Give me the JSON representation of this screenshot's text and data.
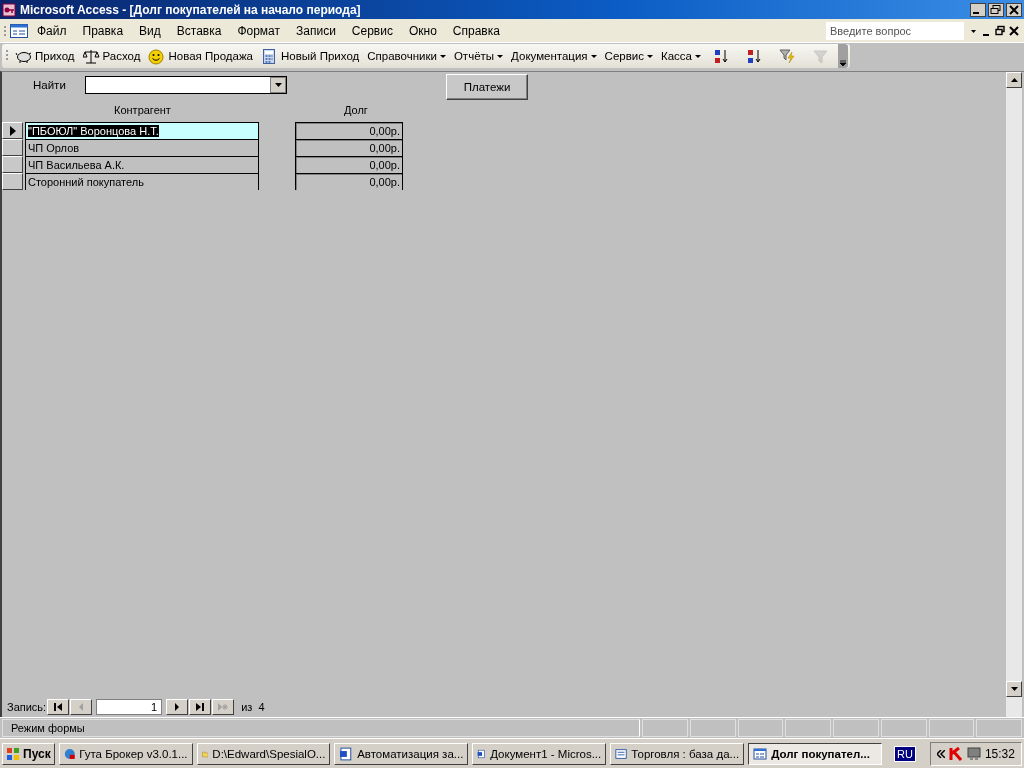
{
  "window": {
    "title": "Microsoft Access - [Долг покупателей на начало периода]"
  },
  "menu": [
    "Файл",
    "Правка",
    "Вид",
    "Вставка",
    "Формат",
    "Записи",
    "Сервис",
    "Окно",
    "Справка"
  ],
  "help_search": {
    "placeholder": "Введите вопрос"
  },
  "toolbar": [
    {
      "kind": "piggy",
      "label": "Приход"
    },
    {
      "kind": "scales",
      "label": "Расход"
    },
    {
      "kind": "smiley",
      "label": "Новая Продажа"
    },
    {
      "kind": "calculator",
      "label": "Новый Приход"
    },
    {
      "kind": "menu",
      "label": "Справочники"
    },
    {
      "kind": "menu",
      "label": "Отчёты"
    },
    {
      "kind": "menu",
      "label": "Документация"
    },
    {
      "kind": "menu",
      "label": "Сервис"
    },
    {
      "kind": "menu",
      "label": "Касса"
    },
    {
      "kind": "sort-asc",
      "disabled": false
    },
    {
      "kind": "sort-desc",
      "disabled": false
    },
    {
      "kind": "filter-apply",
      "disabled": false
    },
    {
      "kind": "filter",
      "disabled": true
    }
  ],
  "form": {
    "search_label": "Найти",
    "button": "Платежи",
    "columns": [
      "Контрагент",
      "Долг"
    ],
    "rows": [
      {
        "selected": true,
        "name": "\"ПБОЮЛ\" Воронцова Н.Т.",
        "debt": "0,00р."
      },
      {
        "selected": false,
        "name": "ЧП Орлов",
        "debt": "0,00р."
      },
      {
        "selected": false,
        "name": "ЧП Васильева А.К.",
        "debt": "0,00р."
      },
      {
        "selected": false,
        "name": "Сторонний покупатель",
        "debt": "0,00р."
      }
    ]
  },
  "record_nav": {
    "label": "Запись:",
    "current": "1",
    "of": "из",
    "total": "4"
  },
  "status_bar": "Режим формы",
  "taskbar": {
    "start": "Пуск",
    "tasks": [
      {
        "label": "Гута Брокер v3.0.1...",
        "selected": false
      },
      {
        "label": "D:\\Edward\\SpesialO...",
        "selected": false
      },
      {
        "label": "Автоматизация за...",
        "selected": false
      },
      {
        "label": "Документ1 - Micros...",
        "selected": false
      },
      {
        "label": "Торговля : база да...",
        "selected": false
      },
      {
        "label": "Долг покупател...",
        "selected": true
      }
    ],
    "language": "RU",
    "clock": "15:32"
  }
}
